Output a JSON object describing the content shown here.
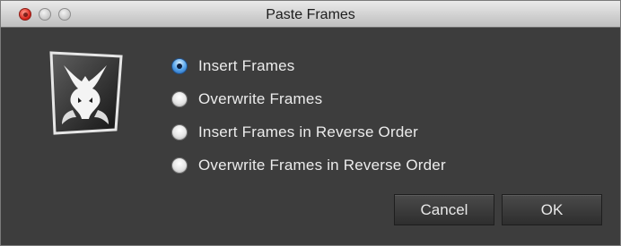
{
  "window": {
    "title": "Paste Frames"
  },
  "logo": {
    "icon": "dragon-logo-icon"
  },
  "options": [
    {
      "label": "Insert Frames",
      "selected": true
    },
    {
      "label": "Overwrite Frames",
      "selected": false
    },
    {
      "label": "Insert Frames in Reverse Order",
      "selected": false
    },
    {
      "label": "Overwrite Frames in Reverse Order",
      "selected": false
    }
  ],
  "buttons": {
    "cancel": "Cancel",
    "ok": "OK"
  },
  "colors": {
    "background": "#3d3d3d",
    "text": "#ececec",
    "selected_radio": "#5aa7ec"
  }
}
